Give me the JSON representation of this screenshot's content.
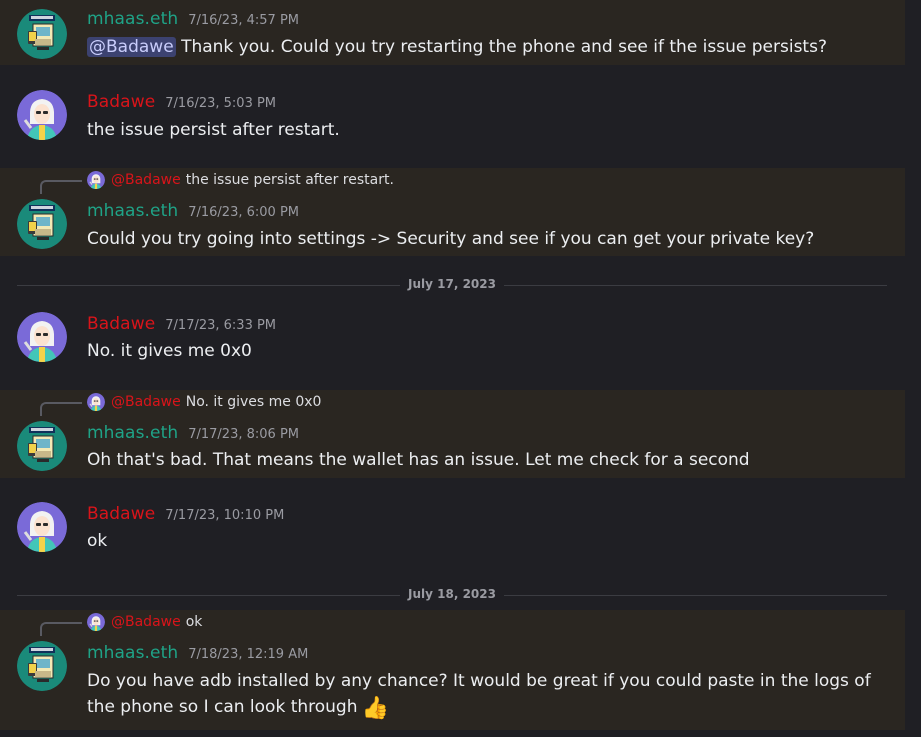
{
  "colors": {
    "background": "#1f1f24",
    "highlight": "#2a2621",
    "mhaas": "#1fa387",
    "badawe": "#d9141a",
    "mention_bg": "#3c4270"
  },
  "messages": [
    {
      "author": "mhaas.eth",
      "timestamp": "7/16/23, 4:57 PM",
      "mention": "@Badawe",
      "text": "Thank you. Could you try restarting the phone and see if the issue persists?"
    },
    {
      "author": "Badawe",
      "timestamp": "7/16/23, 5:03 PM",
      "text": "the issue persist after restart."
    },
    {
      "author": "mhaas.eth",
      "timestamp": "7/16/23, 6:00 PM",
      "reply_name": "@Badawe",
      "reply_text": "the issue persist after restart.",
      "text": "Could you try going into settings -> Security and see if you can get your private key?"
    },
    {
      "author": "Badawe",
      "timestamp": "7/17/23, 6:33 PM",
      "text": "No. it gives me 0x0"
    },
    {
      "author": "mhaas.eth",
      "timestamp": "7/17/23, 8:06 PM",
      "reply_name": "@Badawe",
      "reply_text": "No. it gives me 0x0",
      "text": "Oh that's bad. That means the wallet has an issue. Let me check for a second"
    },
    {
      "author": "Badawe",
      "timestamp": "7/17/23, 10:10 PM",
      "text": "ok"
    },
    {
      "author": "mhaas.eth",
      "timestamp": "7/18/23, 12:19 AM",
      "reply_name": "@Badawe",
      "reply_text": "ok",
      "text_line1": "Do you have adb installed by any chance? It would be great if you could paste in the logs of",
      "text_line2": "the phone so I can look through",
      "emoji": "👍",
      "emoji_icon": "thumbs-up-icon"
    }
  ],
  "dividers": [
    "July 17, 2023",
    "July 18, 2023"
  ]
}
